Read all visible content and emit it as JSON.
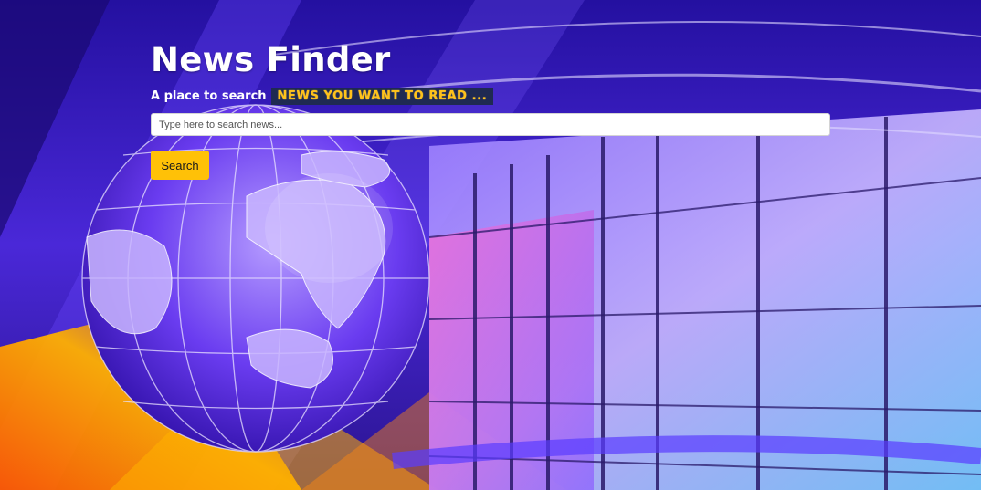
{
  "header": {
    "title": "News Finder",
    "tagline_lead": "A place to search",
    "tagline_highlight": "NEWS YOU WANT TO READ ..."
  },
  "search": {
    "placeholder": "Type here to search news...",
    "value": "",
    "button_label": "Search"
  },
  "colors": {
    "accent": "#ffc107",
    "highlight_text": "#ffc21a",
    "highlight_bg": "#1f2a52"
  },
  "background": {
    "image": "news-studio-globe-backdrop"
  }
}
